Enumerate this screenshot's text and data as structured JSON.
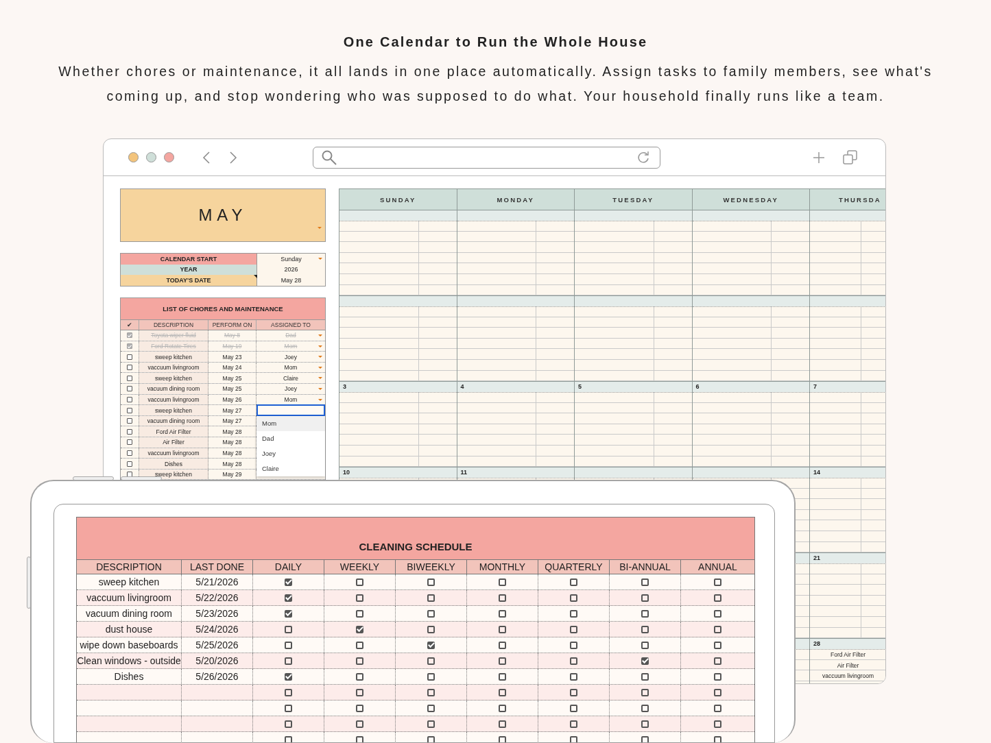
{
  "headline": {
    "title": "One Calendar to Run the Whole House",
    "description": "Whether chores or maintenance, it all lands in one place automatically. Assign tasks to family members, see what's coming up, and stop wondering who was supposed to do what. Your household finally runs like a team."
  },
  "browser": {
    "month": {
      "name": "MAY",
      "dropdown": true
    },
    "settings": [
      {
        "label": "CALENDAR START",
        "value": "Sunday",
        "color": "#f4a6a0",
        "dropdown": true,
        "note": false
      },
      {
        "label": "YEAR",
        "value": "2026",
        "color": "#cfdfd9",
        "dropdown": false,
        "note": false
      },
      {
        "label": "TODAY'S DATE",
        "value": "May 28",
        "color": "#f6d49d",
        "dropdown": false,
        "note": true
      }
    ],
    "chores": {
      "title": "LIST OF CHORES AND MAINTENANCE",
      "columns": [
        "✔",
        "DESCRIPTION",
        "PERFORM ON",
        "ASSIGNED TO"
      ],
      "rows": [
        {
          "done": true,
          "description": "Toyota wiper fluid",
          "perform_on": "May 8",
          "assigned": "Dad"
        },
        {
          "done": true,
          "description": "Ford Rotate Tires",
          "perform_on": "May 19",
          "assigned": "Mom"
        },
        {
          "done": false,
          "description": "sweep kitchen",
          "perform_on": "May 23",
          "assigned": "Joey"
        },
        {
          "done": false,
          "description": "vaccuum livingroom",
          "perform_on": "May 24",
          "assigned": "Mom"
        },
        {
          "done": false,
          "description": "sweep kitchen",
          "perform_on": "May 25",
          "assigned": "Claire"
        },
        {
          "done": false,
          "description": "vacuum dining room",
          "perform_on": "May 25",
          "assigned": "Joey"
        },
        {
          "done": false,
          "description": "vaccuum livingroom",
          "perform_on": "May 26",
          "assigned": "Mom"
        },
        {
          "done": false,
          "description": "sweep kitchen",
          "perform_on": "May 27",
          "dropdown": {
            "options": [
              {
                "label": "Mom",
                "highlighted": true
              },
              {
                "label": "Dad",
                "highlighted": false
              },
              {
                "label": "Joey",
                "highlighted": false
              },
              {
                "label": "Claire",
                "highlighted": false
              }
            ]
          }
        },
        {
          "done": false,
          "description": "vacuum dining room",
          "perform_on": "May 27"
        },
        {
          "done": false,
          "description": "Ford Air Filter",
          "perform_on": "May 28"
        },
        {
          "done": false,
          "description": "Air Filter",
          "perform_on": "May 28"
        },
        {
          "done": false,
          "description": "vaccuum livingroom",
          "perform_on": "May 28"
        },
        {
          "done": false,
          "description": "Dishes",
          "perform_on": "May 28"
        },
        {
          "done": false,
          "description": "sweep kitchen",
          "perform_on": "May 29"
        }
      ]
    },
    "calendar": {
      "day_headers": [
        "SUNDAY",
        "MONDAY",
        "TUESDAY",
        "WEDNESDAY",
        "THURSDA"
      ],
      "weeks": [
        {
          "sun": "3",
          "mon": "4",
          "tue": "5",
          "wed": "6",
          "thu": "7"
        },
        {
          "sun": "10",
          "mon": "11",
          "thu": "14"
        },
        {
          "thu": "21"
        },
        {
          "thu": "28",
          "thu_entries": [
            "Ford Air Filter",
            "Air Filter",
            "vaccuum livingroom"
          ]
        }
      ]
    }
  },
  "tablet": {
    "title": "CLEANING SCHEDULE",
    "columns": [
      "DESCRIPTION",
      "LAST DONE",
      "DAILY",
      "WEEKLY",
      "BIWEEKLY",
      "MONTHLY",
      "QUARTERLY",
      "BI-ANNUAL",
      "ANNUAL"
    ],
    "rows": [
      {
        "description": "sweep kitchen",
        "last_done": "5/21/2026",
        "checks": [
          true,
          false,
          false,
          false,
          false,
          false,
          false
        ]
      },
      {
        "description": "vaccuum livingroom",
        "last_done": "5/22/2026",
        "checks": [
          true,
          false,
          false,
          false,
          false,
          false,
          false
        ]
      },
      {
        "description": "vacuum dining room",
        "last_done": "5/23/2026",
        "checks": [
          true,
          false,
          false,
          false,
          false,
          false,
          false
        ]
      },
      {
        "description": "dust house",
        "last_done": "5/24/2026",
        "checks": [
          false,
          true,
          false,
          false,
          false,
          false,
          false
        ]
      },
      {
        "description": "wipe down baseboards",
        "last_done": "5/25/2026",
        "checks": [
          false,
          false,
          true,
          false,
          false,
          false,
          false
        ]
      },
      {
        "description": "Clean windows - outside",
        "last_done": "5/20/2026",
        "checks": [
          false,
          false,
          false,
          false,
          false,
          true,
          false
        ]
      },
      {
        "description": "Dishes",
        "last_done": "5/26/2026",
        "checks": [
          true,
          false,
          false,
          false,
          false,
          false,
          false
        ]
      },
      {
        "checks": [
          false,
          false,
          false,
          false,
          false,
          false,
          false
        ]
      },
      {
        "checks": [
          false,
          false,
          false,
          false,
          false,
          false,
          false
        ]
      },
      {
        "checks": [
          false,
          false,
          false,
          false,
          false,
          false,
          false
        ]
      },
      {
        "checks": [
          false,
          false,
          false,
          false,
          false,
          false,
          false
        ]
      }
    ]
  }
}
